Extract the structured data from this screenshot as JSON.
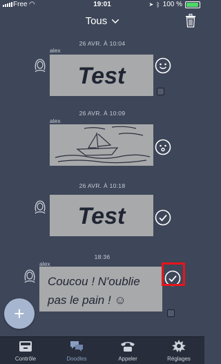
{
  "status_bar": {
    "carrier": "Free",
    "time": "19:01",
    "battery": "100 %"
  },
  "header": {
    "title": "Tous"
  },
  "messages": [
    {
      "timestamp": "26 AVR. À 10:04",
      "sender": "alex",
      "doodle_text": "Test",
      "status": "smiley"
    },
    {
      "timestamp": "26 AVR. À 10:09",
      "sender": "alex",
      "doodle_text": "",
      "status": "surprised"
    },
    {
      "timestamp": "26 AVR. À 10:18",
      "sender": "",
      "doodle_text": "Test",
      "status": "sent"
    },
    {
      "timestamp": "18:36",
      "sender": "alex",
      "doodle_text_line1": "Coucou ! N'oublie",
      "doodle_text_line2": "pas le pain ! ☺",
      "status": "sent"
    }
  ],
  "tabs": [
    {
      "label": "Contrôle",
      "icon": "console-icon"
    },
    {
      "label": "Doodles",
      "icon": "chat-bubbles-icon"
    },
    {
      "label": "Appeler",
      "icon": "phone-icon"
    },
    {
      "label": "Réglages",
      "icon": "gear-icon"
    }
  ],
  "colors": {
    "background": "#3e4659",
    "tabbar": "#272d3a",
    "highlight": "#e8141b",
    "fab": "#a7b6d0"
  }
}
